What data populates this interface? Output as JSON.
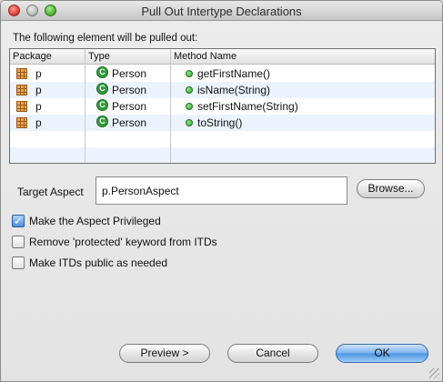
{
  "window": {
    "title": "Pull Out Intertype Declarations"
  },
  "section_label": "The following element will be pulled out:",
  "table": {
    "columns": [
      "Package",
      "Type",
      "Method Name"
    ],
    "rows": [
      {
        "package": "p",
        "type": "Person",
        "method": "getFirstName()"
      },
      {
        "package": "p",
        "type": "Person",
        "method": "isName(String)"
      },
      {
        "package": "p",
        "type": "Person",
        "method": "setFirstName(String)"
      },
      {
        "package": "p",
        "type": "Person",
        "method": "toString()"
      }
    ]
  },
  "target": {
    "label": "Target Aspect",
    "value": "p.PersonAspect",
    "browse_label": "Browse..."
  },
  "options": [
    {
      "label": "Make the Aspect Privileged",
      "checked": true
    },
    {
      "label": "Remove 'protected' keyword from ITDs",
      "checked": false
    },
    {
      "label": "Make ITDs public as needed",
      "checked": false
    }
  ],
  "buttons": {
    "preview_label": "Preview >",
    "cancel_label": "Cancel",
    "ok_label": "OK"
  },
  "icons": {
    "package": "package-icon",
    "type": "class-icon",
    "method": "public-method-icon",
    "class_glyph": "C"
  },
  "colors": {
    "default_button": "#6aa7ea",
    "row_alt": "#edf3fe",
    "method_green": "#2ca12c"
  }
}
